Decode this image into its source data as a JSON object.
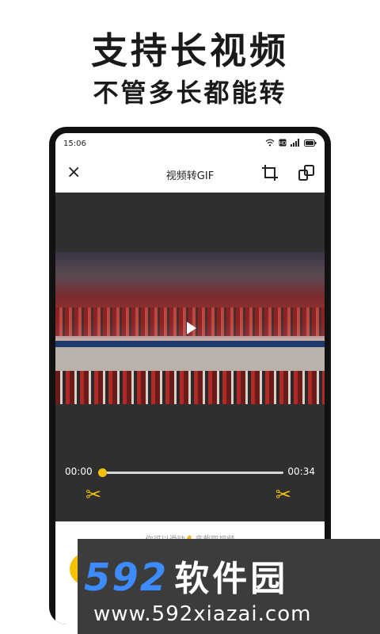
{
  "promo": {
    "headline": "支持长视频",
    "subheadline": "不管多长都能转"
  },
  "status_bar": {
    "time": "15:06",
    "icons": [
      "wifi-icon",
      "hd-icon",
      "signal-icon",
      "battery-icon"
    ]
  },
  "toolbar": {
    "close_icon": "×",
    "title": "视频转GIF",
    "crop_icon": "crop-icon",
    "aspect_icon": "aspect-ratio-icon"
  },
  "video": {
    "play_icon": "play-icon"
  },
  "timeline": {
    "start_time": "00:00",
    "end_time": "00:34",
    "progress": 0.0,
    "scissor_icon": "✂"
  },
  "bottom": {
    "hint_prefix": "你可以滑动",
    "hint_hand": "✋",
    "hint_suffix": "来截取视频"
  },
  "watermark": {
    "logo_number": "592",
    "logo_text": "软件园",
    "url": "www.592xiazai.com"
  },
  "colors": {
    "accent": "#f4c20d",
    "logo_blue": "#3d8cff",
    "video_bg": "#2f2f2f"
  }
}
